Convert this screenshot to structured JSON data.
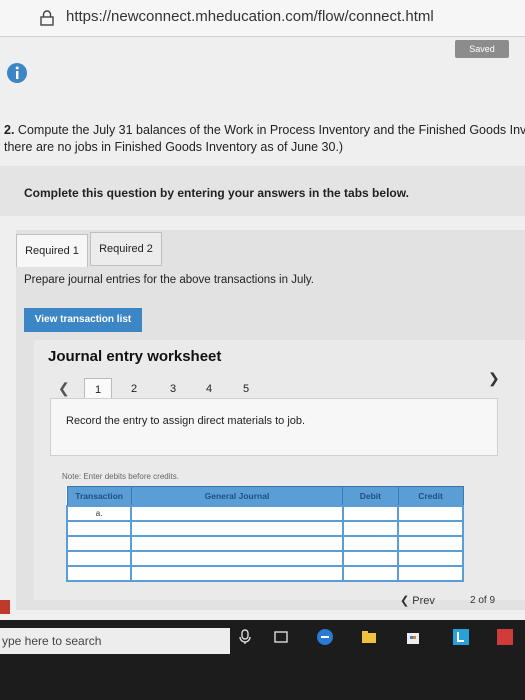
{
  "browser": {
    "url": "https://newconnect.mheducation.com/flow/connect.html"
  },
  "status": {
    "saved_label": "Saved"
  },
  "question": {
    "number": "2.",
    "line1": "Compute the July 31 balances of the Work in Process Inventory and the Finished Goods Inv",
    "line2": "there are no jobs in Finished Goods Inventory as of June 30.)"
  },
  "instruction": "Complete this question by entering your answers in the tabs below.",
  "tabs": [
    {
      "label": "Required 1"
    },
    {
      "label": "Required 2"
    }
  ],
  "tab_content": {
    "prompt": "Prepare journal entries for the above transactions in July.",
    "view_button": "View transaction list"
  },
  "worksheet": {
    "title": "Journal entry worksheet",
    "pages": [
      "1",
      "2",
      "3",
      "4",
      "5"
    ],
    "active_page": "1",
    "record_text": "Record the entry to assign direct materials to job.",
    "note": "Note: Enter debits before credits.",
    "table": {
      "headers": [
        "Transaction",
        "General Journal",
        "Debit",
        "Credit"
      ],
      "first_transaction": "a."
    }
  },
  "navigation": {
    "prev_label": "Prev",
    "page": "2",
    "of_label": "of",
    "total": "9"
  },
  "taskbar": {
    "search_placeholder": "ype here to search"
  },
  "colors": {
    "accent": "#3d86c6",
    "table_header": "#5b9ed6"
  }
}
